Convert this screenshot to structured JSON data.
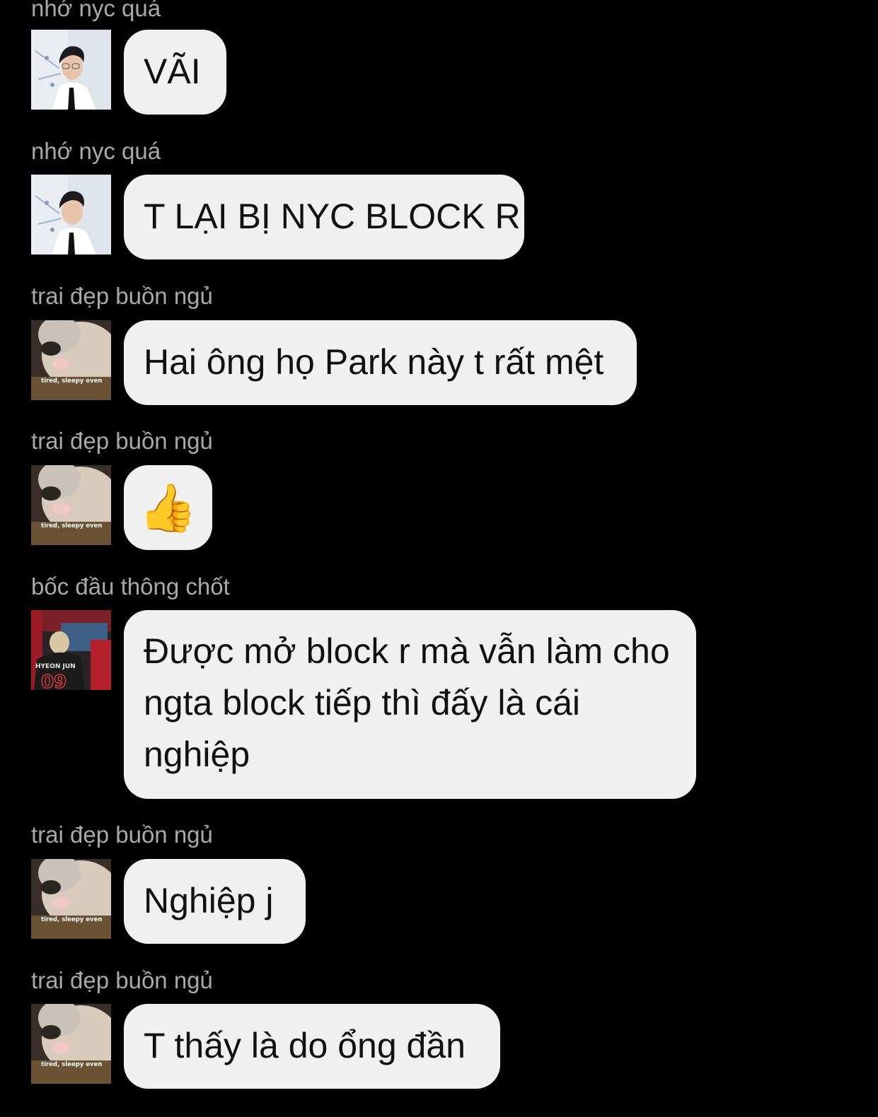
{
  "colors": {
    "background": "#000000",
    "sender_name": "#a9a9a9",
    "bubble_bg": "#f0f0f0",
    "bubble_text": "#111111"
  },
  "messages": [
    {
      "sender": "nhớ nyc quá",
      "avatar": "avatar-man-in-suit",
      "text": "VÃI"
    },
    {
      "sender": "nhớ nyc quá",
      "avatar": "avatar-man-in-suit",
      "text": "T LẠI BỊ NYC BLOCK R"
    },
    {
      "sender": "trai đẹp buồn ngủ",
      "avatar": "avatar-sleepy-cat",
      "text": "Hai ông họ Park này t rất mệt"
    },
    {
      "sender": "trai đẹp buồn ngủ",
      "avatar": "avatar-sleepy-cat",
      "text": "👍"
    },
    {
      "sender": "bốc đầu thông chốt",
      "avatar": "avatar-jersey-09",
      "text": "Được mở block r mà vẫn làm cho ngta block tiếp thì đấy là cái nghiệp"
    },
    {
      "sender": "trai đẹp buồn ngủ",
      "avatar": "avatar-sleepy-cat",
      "text": "Nghiệp j"
    },
    {
      "sender": "trai đẹp buồn ngủ",
      "avatar": "avatar-sleepy-cat",
      "text": "T thấy là do ổng đần"
    }
  ],
  "avatar_captions": {
    "sleepy_cat": "tired, sleepy even",
    "jersey_name": "HYEON JUN",
    "jersey_number": "09"
  }
}
